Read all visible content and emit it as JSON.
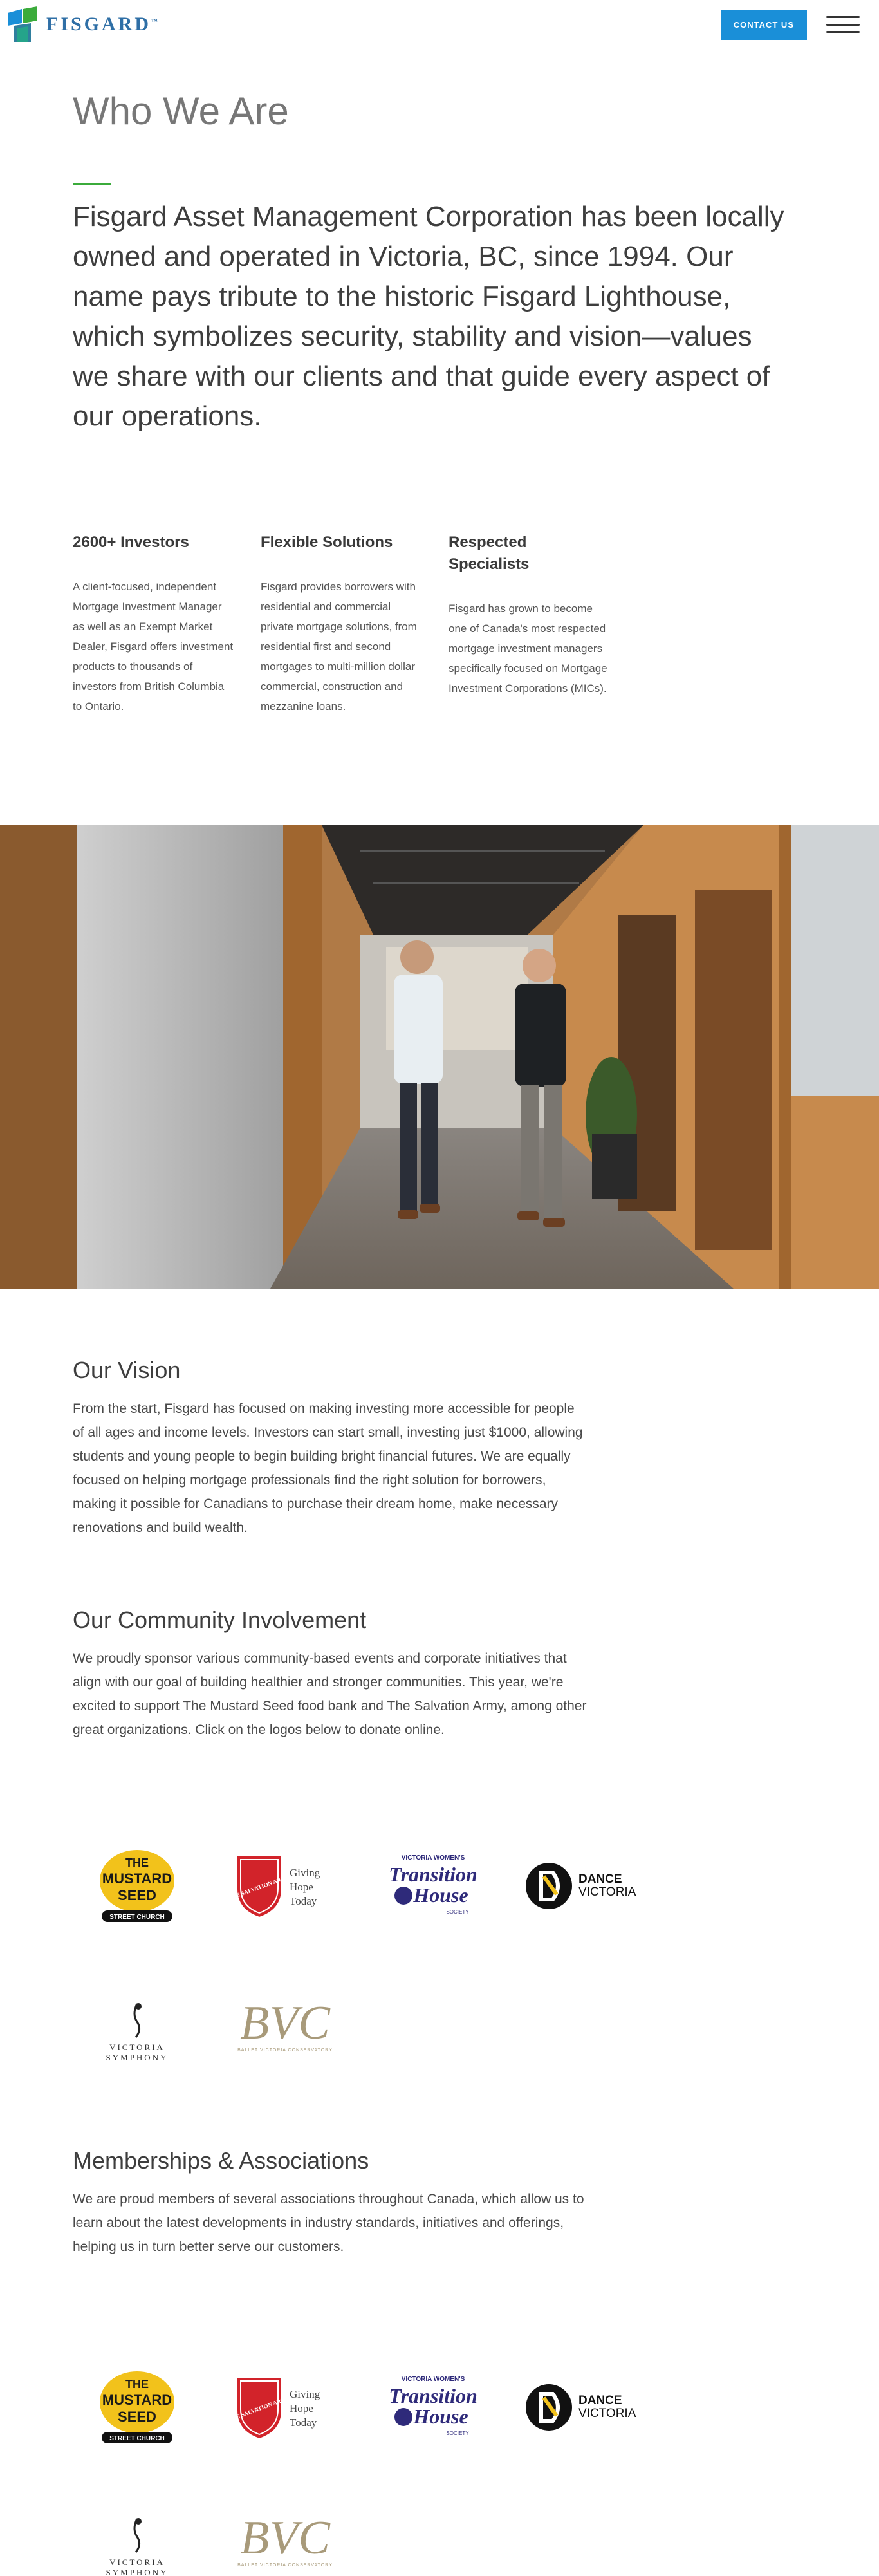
{
  "header": {
    "brand": "FISGARD",
    "trademark": "™",
    "contact_label": "CONTACT US"
  },
  "intro": {
    "title": "Who We Are",
    "lead": "Fisgard Asset Management Corporation has been locally owned and operated in Victoria, BC, since 1994. Our name pays tribute to the historic Fisgard Lighthouse, which symbolizes security, stability and vision—values we share with our clients and that guide every aspect of our operations."
  },
  "features": [
    {
      "title": "2600+ Investors",
      "body": "A client-focused, independent Mortgage Investment Manager as well as an Exempt Market Dealer, Fisgard offers investment products to thousands of investors from British Columbia to Ontario."
    },
    {
      "title": "Flexible Solutions",
      "body": "Fisgard provides borrowers with residential and commercial private mortgage solutions, from residential first and second mortgages to multi-million dollar commercial, construction and mezzanine loans."
    },
    {
      "title": "Respected Specialists",
      "body": "Fisgard has grown to become one of Canada's most respected mortgage investment managers specifically focused on Mortgage Investment Corporations (MICs)."
    }
  ],
  "vision": {
    "title": "Our Vision",
    "body": "From the start, Fisgard has focused on making investing more accessible for people of all ages and income levels. Investors can start small, investing just $1000, allowing students and young people to begin building bright financial futures. We are equally focused on helping mortgage professionals find the right solution for borrowers, making it possible for Canadians to purchase their dream home, make necessary renovations and build wealth."
  },
  "community": {
    "title": "Our Community Involvement",
    "body": "We proudly sponsor various community-based events and corporate initiatives that align with our goal of building healthier and stronger communities. This year, we're excited to support The Mustard Seed food bank and The Salvation Army, among other great organizations. Click on the logos below to donate online."
  },
  "memberships": {
    "title": "Memberships & Associations",
    "body": "We are proud members of several associations throughout Canada, which allow us to learn about the latest developments in industry standards, initiatives and offerings, helping us in turn better serve our customers."
  },
  "logos": {
    "mustard_line1": "THE",
    "mustard_line2": "MUSTARD",
    "mustard_line3": "SEED",
    "mustard_tag": "STREET CHURCH",
    "salvation_shield": "THE SALVATION ARMY",
    "salvation_tag1": "Giving",
    "salvation_tag2": "Hope",
    "salvation_tag3": "Today",
    "transition_top": "VICTORIA WOMEN'S",
    "transition_mid": "Transition",
    "transition_bot": "House",
    "transition_soc": "SOCIETY",
    "dance1": "DANCE",
    "dance2": "VICTORIA",
    "symphony1": "VICTORIA",
    "symphony2": "SYMPHONY",
    "bvc": "BVC",
    "bvc_tag": "BALLET VICTORIA CONSERVATORY"
  },
  "colors": {
    "accent_blue": "#1a8fd8",
    "accent_green": "#3bab3b",
    "mustard_yellow": "#f2c21b",
    "salvation_red": "#d2232a",
    "transition_navy": "#2e2a7a"
  }
}
